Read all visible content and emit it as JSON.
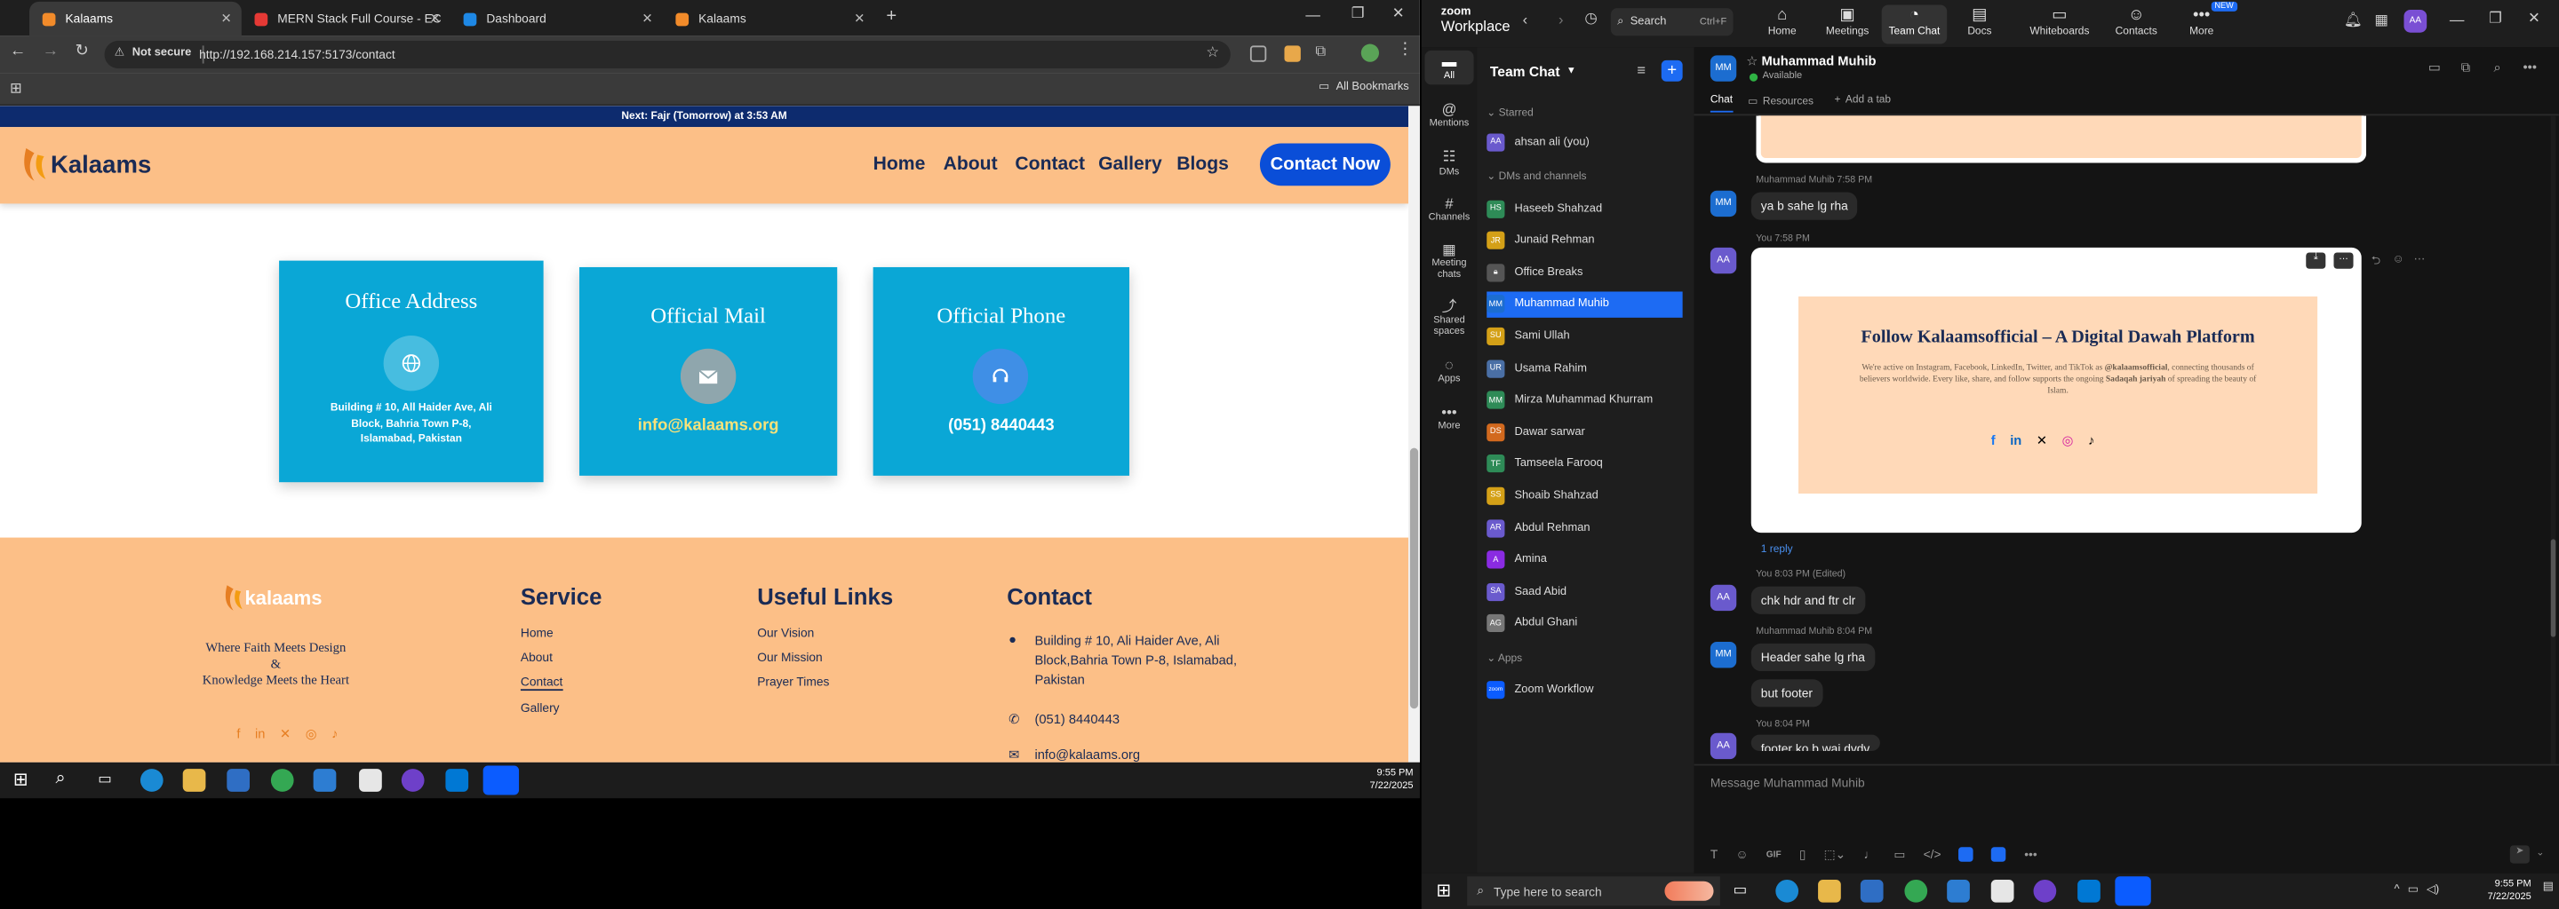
{
  "browser": {
    "tabs": [
      {
        "title": "Kalaams",
        "active": true,
        "fav": "#f28b2a"
      },
      {
        "title": "MERN Stack Full Course - ECom",
        "active": false,
        "fav": "#e53935"
      },
      {
        "title": "Dashboard",
        "active": false,
        "fav": "#1e88e5"
      },
      {
        "title": "Kalaams",
        "active": false,
        "fav": "#f28b2a"
      }
    ],
    "security": "Not secure",
    "url": "http://192.168.214.157:5173/contact",
    "bookmarks_label": "All Bookmarks"
  },
  "site": {
    "announcement": "Next: Fajr (Tomorrow) at 3:53 AM",
    "logo": "Kalaams",
    "nav": [
      "Home",
      "About",
      "Contact",
      "Gallery",
      "Blogs"
    ],
    "cta": "Contact Now",
    "cards": [
      {
        "title": "Office Address",
        "value": "Building # 10, All Haider Ave, Ali Block, Bahria Town P-8, Islamabad, Pakistan",
        "icon": "globe-icon"
      },
      {
        "title": "Official Mail",
        "value": "info@kalaams.org",
        "icon": "mail-icon"
      },
      {
        "title": "Official Phone",
        "value": "(051) 8440443",
        "icon": "headset-icon"
      }
    ],
    "footer": {
      "logo": "kalaams",
      "tagline1": "Where Faith Meets Design",
      "tagline2": "&",
      "tagline3": "Knowledge Meets the Heart",
      "service_title": "Service",
      "service": [
        "Home",
        "About",
        "Contact",
        "Gallery"
      ],
      "links_title": "Useful Links",
      "links": [
        "Our Vision",
        "Our Mission",
        "Prayer Times"
      ],
      "contact_title": "Contact",
      "address": "Building # 10, Ali Haider Ave, Ali Block,Bahria Town P-8, Islamabad, Pakistan",
      "phone": "(051) 8440443",
      "email": "info@kalaams.org"
    }
  },
  "taskbar_left": {
    "time": "9:55 PM",
    "date": "7/22/2025"
  },
  "zoom": {
    "brand_top": "zoom",
    "brand_bottom": "Workplace",
    "search": "Search",
    "search_shortcut": "Ctrl+F",
    "top_tabs": [
      "Home",
      "Meetings",
      "Team Chat",
      "Docs",
      "Whiteboards",
      "Contacts",
      "More"
    ],
    "new_badge": "NEW",
    "user_initials": "AA",
    "rail": [
      "All",
      "Mentions",
      "DMs",
      "Channels",
      "Meeting chats",
      "Shared spaces",
      "Apps",
      "More"
    ],
    "list_title": "Team Chat",
    "starred": "Starred",
    "dms_section": "DMs and channels",
    "apps_section": "Apps",
    "starred_items": [
      {
        "name": "ahsan ali (you)",
        "ini": "AA",
        "color": "#6a5acd"
      }
    ],
    "dm_items": [
      {
        "name": "Haseeb Shahzad",
        "ini": "HS",
        "color": "#2e8b57"
      },
      {
        "name": "Junaid Rehman",
        "ini": "JR",
        "color": "#d4a017"
      },
      {
        "name": "Office Breaks",
        "ini": "",
        "color": "#555555"
      },
      {
        "name": "Muhammad Muhib",
        "ini": "MM",
        "color": "#1c6dd0"
      },
      {
        "name": "Sami Ullah",
        "ini": "SU",
        "color": "#d4a017"
      },
      {
        "name": "Usama Rahim",
        "ini": "UR",
        "color": "#4a6fa5"
      },
      {
        "name": "Mirza Muhammad Khurram",
        "ini": "MM",
        "color": "#2e8b57"
      },
      {
        "name": "Dawar sarwar",
        "ini": "DS",
        "color": "#d2691e"
      },
      {
        "name": "Tamseela Farooq",
        "ini": "TF",
        "color": "#2e8b57"
      },
      {
        "name": "Shoaib Shahzad",
        "ini": "SS",
        "color": "#d4a017"
      },
      {
        "name": "Abdul Rehman",
        "ini": "AR",
        "color": "#6a5acd"
      },
      {
        "name": "Amina",
        "ini": "A",
        "color": "#8a2be2"
      },
      {
        "name": "Saad Abid",
        "ini": "SA",
        "color": "#6a5acd"
      },
      {
        "name": "Abdul Ghani",
        "ini": "AG",
        "color": "#777777"
      }
    ],
    "app_items": [
      {
        "name": "Zoom Workflow",
        "ini": "zoom",
        "color": "#0b5cff"
      }
    ],
    "chat": {
      "name": "Muhammad Muhib",
      "status": "Available",
      "tabs": [
        "Chat",
        "Resources",
        "Add a tab"
      ],
      "m1_meta": "Muhammad Muhib 7:58 PM",
      "m1_text": "ya b sahe lg rha",
      "m2_meta": "You 7:58 PM",
      "follow_title": "Follow Kalaamsofficial – A Digital Dawah Platform",
      "follow_body_a": "We're active on Instagram, Facebook, LinkedIn, Twitter, and TikTok as ",
      "follow_handle": "@kalaamsofficial",
      "follow_body_b": ", connecting thousands of believers worldwide. Every like, share, and follow supports the ongoing ",
      "follow_sj": "Sadaqah jariyah",
      "follow_body_c": " of spreading the beauty of Islam.",
      "reply": "1 reply",
      "m3_meta": "You 8:03 PM (Edited)",
      "m3_text": "chk hdr and ftr clr",
      "m4_meta": "Muhammad Muhib 8:04 PM",
      "m4_text": "Header sahe lg rha",
      "m5_text": "but footer",
      "m6_meta": "You 8:04 PM",
      "m6_text": "footer ko b wai dvdv",
      "compose_placeholder": "Message Muhammad Muhib",
      "gif": "GIF"
    }
  },
  "taskbar_right": {
    "search": "Type here to search",
    "time": "9:55 PM",
    "date": "7/22/2025"
  }
}
